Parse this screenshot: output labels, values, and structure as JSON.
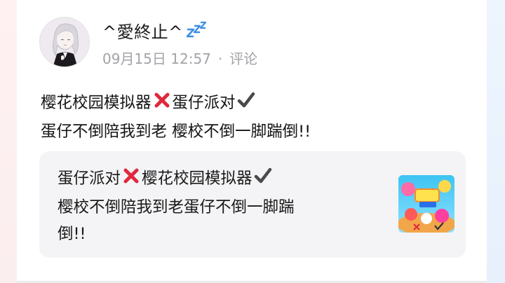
{
  "post": {
    "username": "^愛終止^",
    "username_emoji": "zzz-emoji",
    "date": "09月15日 12:57",
    "separator": "·",
    "comment_label": "评论",
    "line1_a": "樱花校园模拟器",
    "line1_b": "蛋仔派对",
    "line2": "蛋仔不倒陪我到老 樱校不倒一脚踹倒!!"
  },
  "shared": {
    "line1_a": "蛋仔派对",
    "line1_b": "樱花校园模拟器",
    "line2": "樱校不倒陪我到老蛋仔不倒一脚踹",
    "line3": "倒!!",
    "thumbnail_icon": "game-cover-thumbnail"
  },
  "colors": {
    "card_bg": "#ffffff",
    "share_bg": "#f4f4f6",
    "meta_text": "#a3a3a8",
    "cross_mark": "#e0283c",
    "check_mark": "#4a4a4a",
    "zzz": "#3a8fe6"
  }
}
